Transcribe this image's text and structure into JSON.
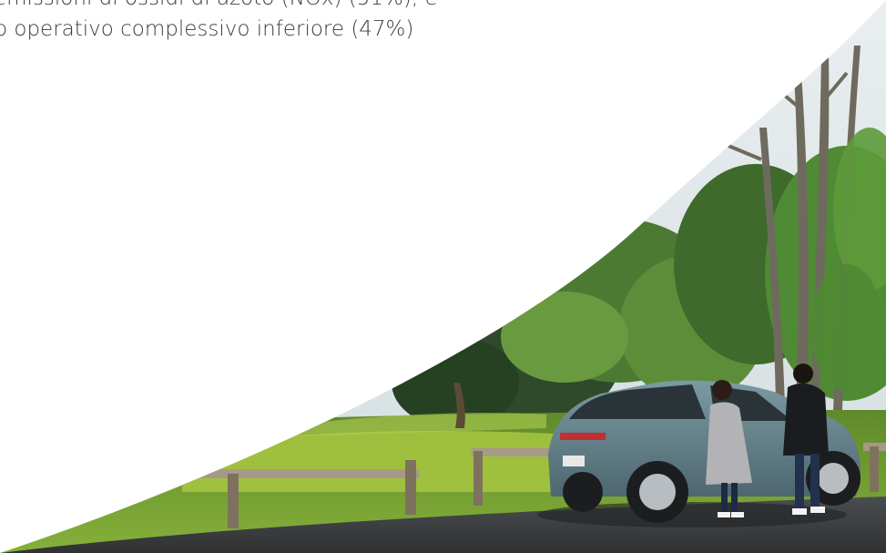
{
  "text": {
    "line1": "emissioni di ossidi di azoto (NOx) (51%), e",
    "line2": "o operativo complessivo inferiore (47%)"
  },
  "colors": {
    "text": "#3c3c3c",
    "sky": "#dfe6ea",
    "car": "#5f7d86",
    "lawn_sunny": "#9bbf3a",
    "road": "#3a3d40"
  }
}
